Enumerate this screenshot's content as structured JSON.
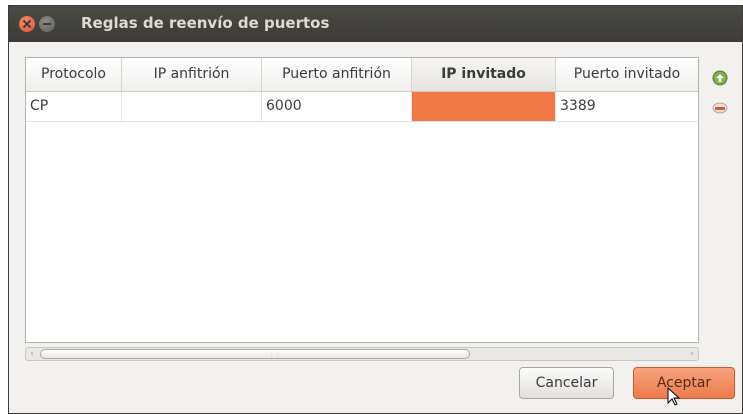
{
  "window": {
    "title": "Reglas de reenvío de puertos"
  },
  "table": {
    "columns": [
      "Protocolo",
      "IP anfitrión",
      "Puerto anfitrión",
      "IP invitado",
      "Puerto invitado"
    ],
    "sorted_column": "IP invitado",
    "rows": [
      {
        "protocol": "CP",
        "host_ip": "",
        "host_port": "6000",
        "guest_ip": "",
        "guest_port": "3389"
      }
    ]
  },
  "side_buttons": {
    "add_icon": "add-rule-icon",
    "remove_icon": "remove-rule-icon"
  },
  "buttons": {
    "cancel": "Cancelar",
    "accept": "Aceptar"
  },
  "colors": {
    "accent": "#f07746",
    "titlebar": "#3c3b37"
  }
}
